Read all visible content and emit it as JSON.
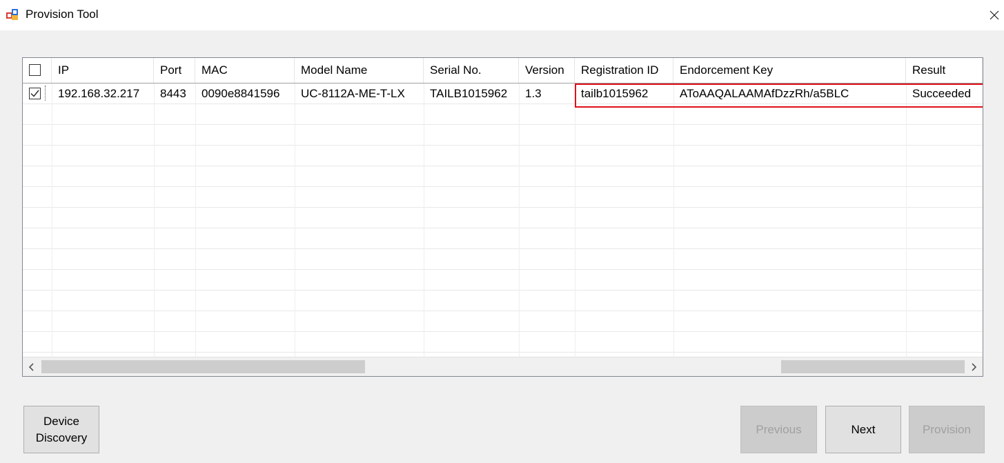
{
  "window": {
    "title": "Provision Tool",
    "app_icon": "app-window-icon",
    "close_icon": "close-icon"
  },
  "grid": {
    "columns": [
      "IP",
      "Port",
      "MAC",
      "Model Name",
      "Serial No.",
      "Version",
      "Registration ID",
      "Endorcement Key",
      "Result"
    ],
    "select_all_checked": false,
    "rows": [
      {
        "checked": true,
        "cells": [
          "192.168.32.217",
          "8443",
          "0090e8841596",
          "UC-8112A-ME-T-LX",
          "TAILB1015962",
          "1.3",
          "tailb1015962",
          "AToAAQALAAMAfDzzRh/a5BLC",
          "Succeeded"
        ]
      }
    ],
    "highlight_color": "#e0101a",
    "scrollbar": {
      "left_arrow": "‹",
      "right_arrow": "›"
    }
  },
  "buttons": {
    "device_discovery": "Device\nDiscovery",
    "previous": "Previous",
    "next": "Next",
    "provision": "Provision"
  },
  "colors": {
    "window_bg": "#f0f0f0",
    "disabled_text": "#a0a0a0"
  }
}
